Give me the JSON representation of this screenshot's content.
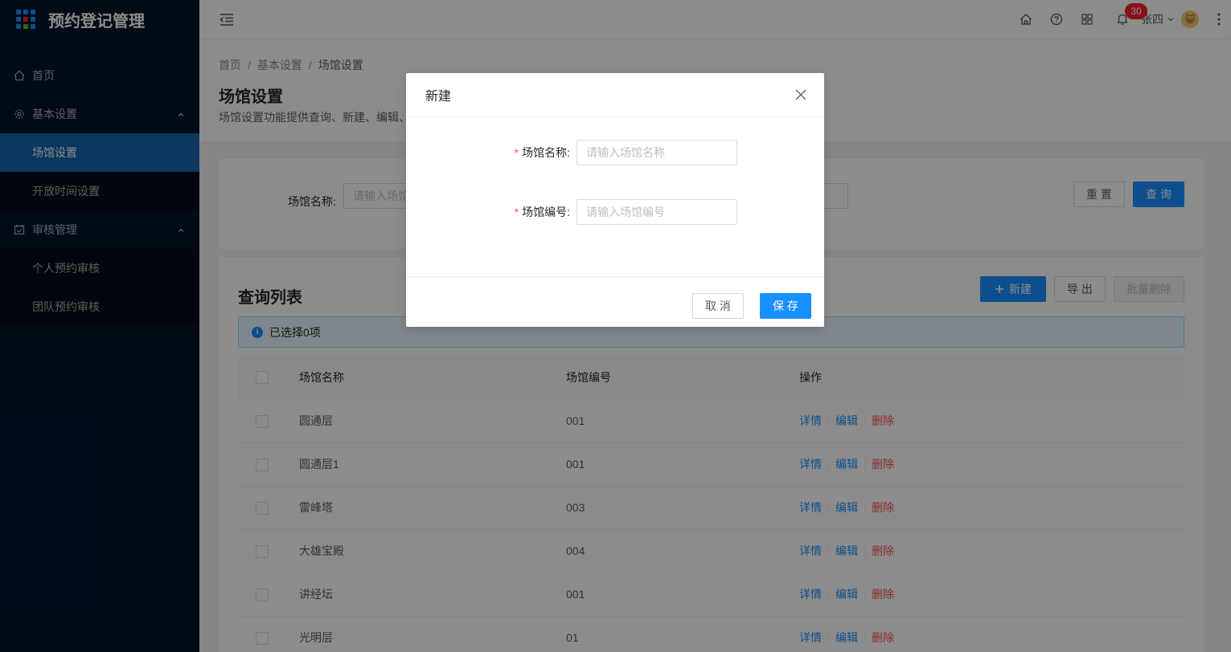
{
  "app": {
    "title": "预约登记管理"
  },
  "sidebar": {
    "items": [
      {
        "label": "首页"
      },
      {
        "label": "基本设置"
      },
      {
        "label": "场馆设置"
      },
      {
        "label": "开放时间设置"
      },
      {
        "label": "审核管理"
      },
      {
        "label": "个人预约审核"
      },
      {
        "label": "团队预约审核"
      }
    ]
  },
  "header": {
    "notification_count": "30",
    "user_name": "张四",
    "avatar_text": "😺"
  },
  "breadcrumb": [
    "首页",
    "基本设置",
    "场馆设置"
  ],
  "page": {
    "title": "场馆设置",
    "description": "场馆设置功能提供查询、新建、编辑、"
  },
  "search": {
    "name_label": "场馆名称:",
    "name_placeholder": "请输入场馆",
    "reset_label": "重 置",
    "query_label": "查 询"
  },
  "list": {
    "title": "查询列表",
    "new_label": "新建",
    "export_label": "导 出",
    "batch_delete_label": "批量删除",
    "selected_text": "已选择0项",
    "columns": [
      "场馆名称",
      "场馆编号",
      "操作"
    ],
    "actions": {
      "detail": "详情",
      "edit": "编辑",
      "delete": "删除"
    },
    "rows": [
      {
        "name": "圆通层",
        "code": "001"
      },
      {
        "name": "圆通层1",
        "code": "001"
      },
      {
        "name": "雷峰塔",
        "code": "003"
      },
      {
        "name": "大雄宝殿",
        "code": "004"
      },
      {
        "name": "讲经坛",
        "code": "001"
      },
      {
        "name": "光明层",
        "code": "01"
      }
    ]
  },
  "modal": {
    "title": "新建",
    "fields": [
      {
        "label": "场馆名称:",
        "placeholder": "请输入场馆名称",
        "value": ""
      },
      {
        "label": "场馆编号:",
        "placeholder": "请输入场馆编号",
        "value": ""
      }
    ],
    "cancel_label": "取 消",
    "save_label": "保 存"
  },
  "colors": {
    "sidebar_bg": "#001529",
    "active_menu": "#1765ad",
    "primary": "#1890ff",
    "danger": "#ff4d4f"
  }
}
